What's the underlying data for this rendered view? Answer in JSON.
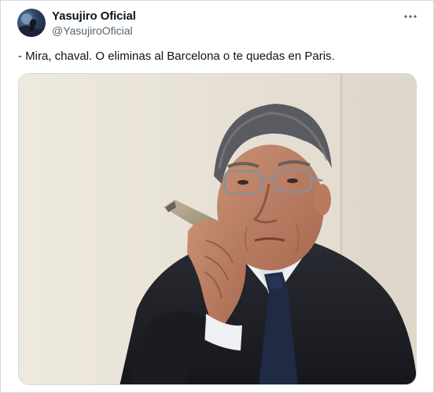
{
  "tweet": {
    "author_name": "Yasujiro Oficial",
    "author_handle": "@YasujiroOficial",
    "text": "- Mira, chaval. O eliminas al Barcelona o te quedas en Paris.",
    "more_icon": "more-horizontal-icon",
    "media_description_icon": "photo"
  }
}
